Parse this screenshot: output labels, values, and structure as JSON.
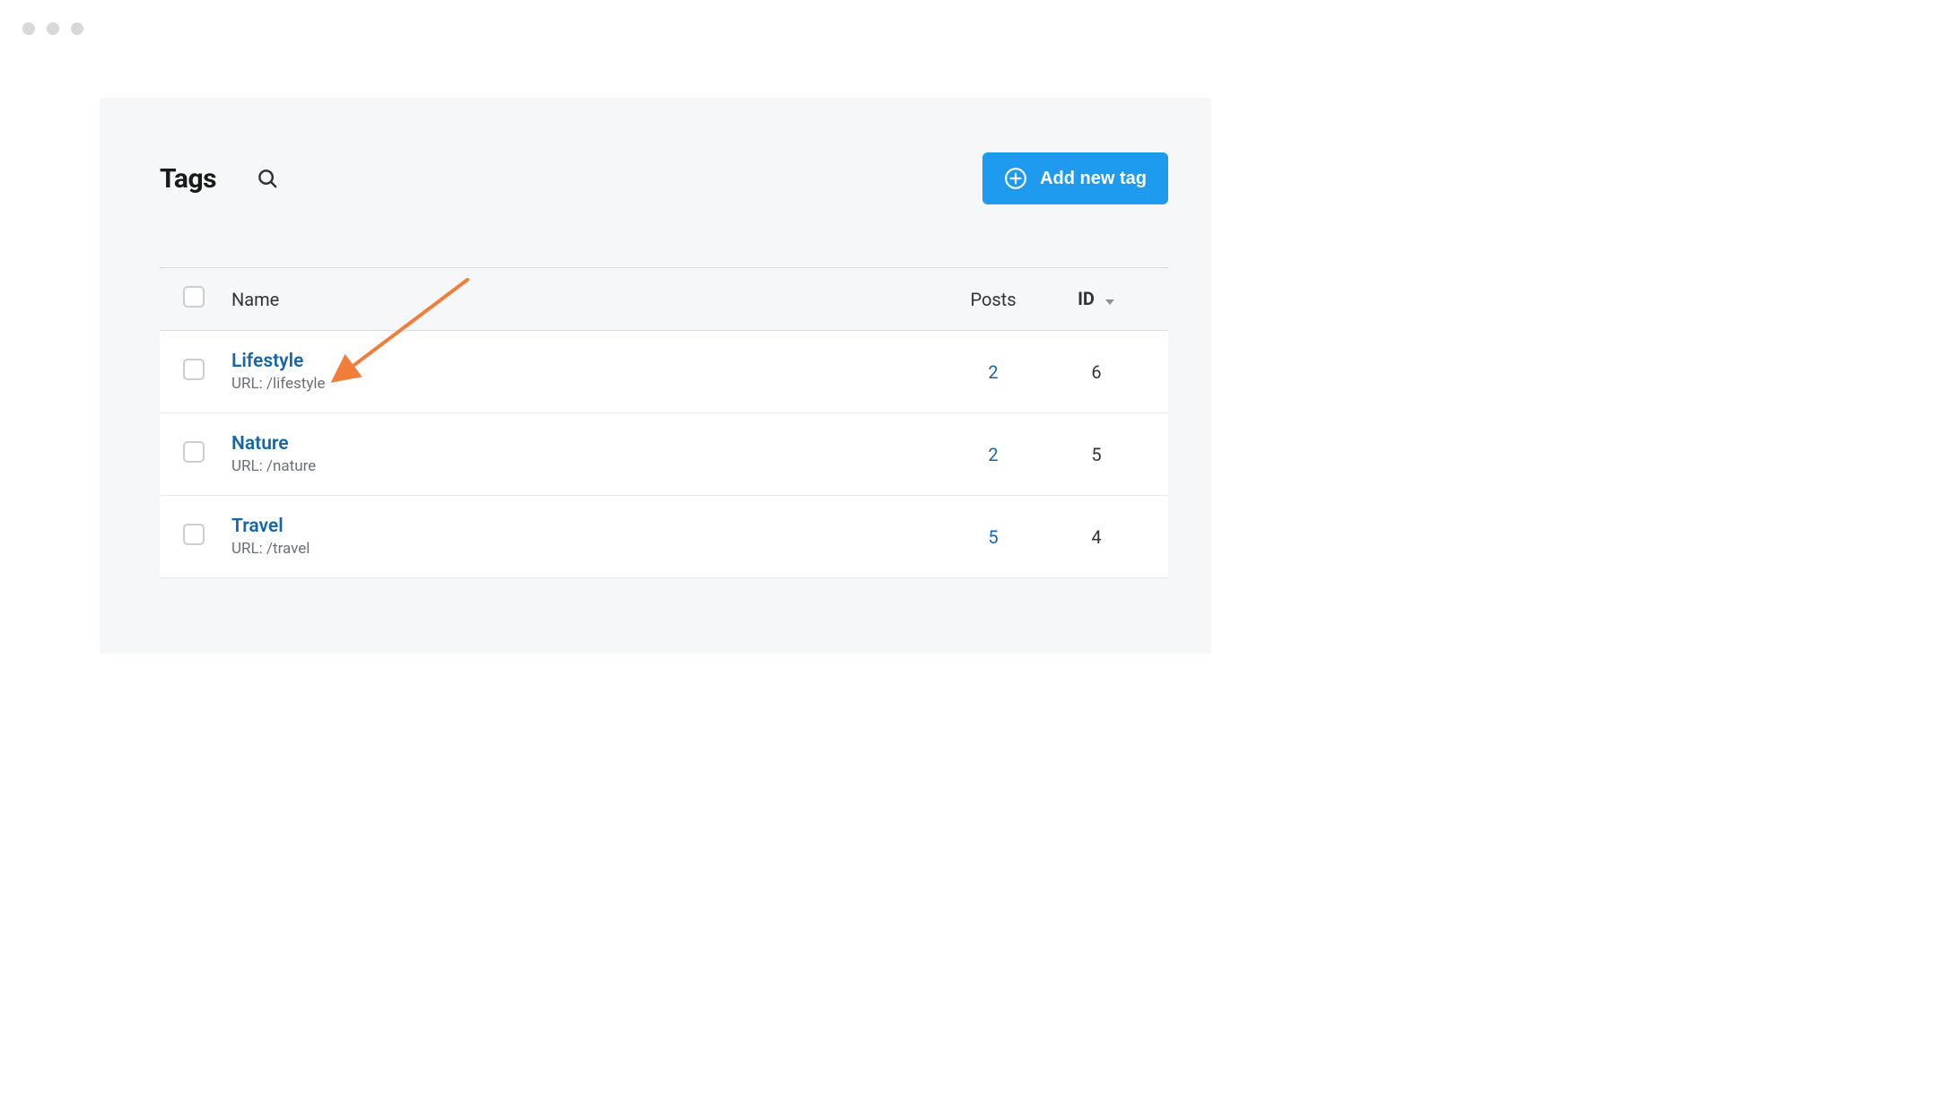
{
  "header": {
    "title": "Tags",
    "add_button_label": "Add new tag"
  },
  "table": {
    "columns": {
      "name": "Name",
      "posts": "Posts",
      "id": "ID"
    },
    "url_prefix": "URL: ",
    "rows": [
      {
        "name": "Lifestyle",
        "url": "/lifestyle",
        "posts": "2",
        "id": "6"
      },
      {
        "name": "Nature",
        "url": "/nature",
        "posts": "2",
        "id": "5"
      },
      {
        "name": "Travel",
        "url": "/travel",
        "posts": "5",
        "id": "4"
      }
    ]
  },
  "colors": {
    "accent": "#1e9aee",
    "link": "#1766a6",
    "annotation_arrow": "#f07e3a"
  }
}
